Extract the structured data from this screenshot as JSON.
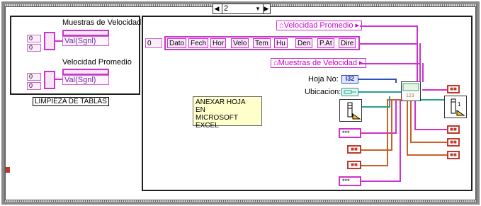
{
  "selector": {
    "left_arrow": "◀",
    "value": "2",
    "dropdown": "▾",
    "right_arrow": "▶"
  },
  "left_panel": {
    "ctrl1": {
      "title": "Muestras de Velocidad",
      "index1": "0",
      "index2": "0",
      "label": "Val(Sgnl)"
    },
    "ctrl2": {
      "title": "Velocidad Promedio",
      "index1": "0",
      "index2": "0",
      "label": "Val(Sgnl)"
    },
    "caption": "LIMPIEZA DE TABLAS"
  },
  "main": {
    "header_index": "0",
    "headers": [
      "Dato",
      "Fech",
      "Hor",
      "Velo",
      "Tem",
      "Hu",
      "Den",
      "P.At",
      "Dire"
    ],
    "prop_velocidad": "Velocidad Promedio",
    "prop_muestras": "Muestras de Velocidad",
    "hoja_label": "Hoja No:",
    "hoja_type": "I32",
    "ubicacion_label": "Ubicacion:",
    "comment_lines": [
      "ANEXAR HOJA",
      "EN",
      "MICROSOFT EXCEL"
    ],
    "stars1": "***",
    "stars2": "***",
    "excel_num": "123",
    "excel_one": "1"
  },
  "colors": {
    "pink": "#cc33cc",
    "orange": "#c8602a",
    "teal": "#2e9e8e",
    "border": "#202020"
  }
}
